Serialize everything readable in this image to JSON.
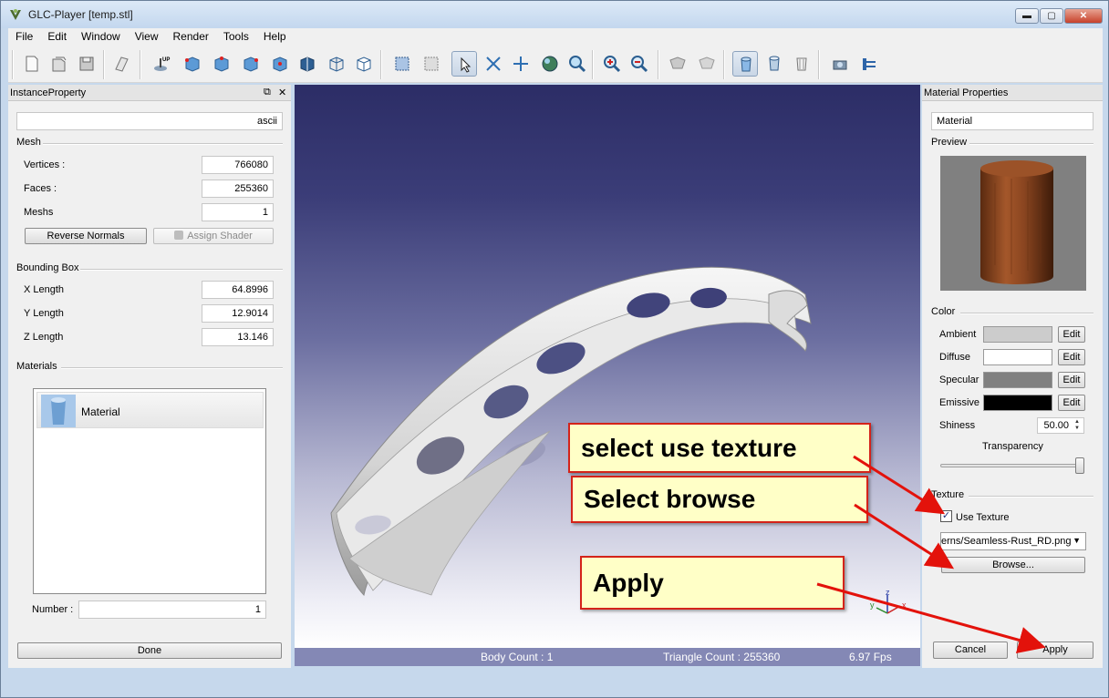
{
  "window": {
    "title": "GLC-Player [temp.stl]",
    "min": "▬",
    "max": "▢",
    "close": "✕"
  },
  "menu": [
    "File",
    "Edit",
    "Window",
    "View",
    "Render",
    "Tools",
    "Help"
  ],
  "instance_property": {
    "title": "InstanceProperty",
    "float_glyph": "⧉",
    "close_glyph": "✕",
    "name_value": "ascii",
    "mesh_header": "Mesh",
    "vertices_label": "Vertices :",
    "vertices_value": "766080",
    "faces_label": "Faces :",
    "faces_value": "255360",
    "meshs_label": "Meshs",
    "meshs_value": "1",
    "reverse_normals": "Reverse Normals",
    "assign_shader": "Assign Shader",
    "bbox_header": "Bounding Box",
    "x_label": "X Length",
    "x_value": "64.8996",
    "y_label": "Y Length",
    "y_value": "12.9014",
    "z_label": "Z Length",
    "z_value": "13.146",
    "materials_header": "Materials",
    "material_item": "Material",
    "number_label": "Number :",
    "number_value": "1",
    "done": "Done"
  },
  "viewport": {
    "body_count": "Body Count : 1",
    "triangle_count": "Triangle Count : 255360",
    "fps": "6.97 Fps",
    "axis_x": "x",
    "axis_y": "y",
    "axis_z": "z"
  },
  "material_properties": {
    "title": "Material Properties",
    "name_value": "Material",
    "preview_label": "Preview",
    "color_header": "Color",
    "ambient_label": "Ambient",
    "diffuse_label": "Diffuse",
    "specular_label": "Specular",
    "emissive_label": "Emissive",
    "edit": "Edit",
    "shininess_label": "Shiness",
    "shininess_value": "50.00",
    "transparency_label": "Transparency",
    "texture_header": "Texture",
    "use_texture_label": "Use Texture",
    "checkmark": "✓",
    "texture_path": "erns/Seamless-Rust_RD.png",
    "browse": "Browse...",
    "cancel": "Cancel",
    "apply": "Apply",
    "colors": {
      "ambient": "#cccccc",
      "diffuse": "#ffffff",
      "specular": "#808080",
      "emissive": "#000000"
    }
  },
  "annotations": {
    "use_texture": "select use texture",
    "browse": "Select browse",
    "apply": "Apply"
  }
}
